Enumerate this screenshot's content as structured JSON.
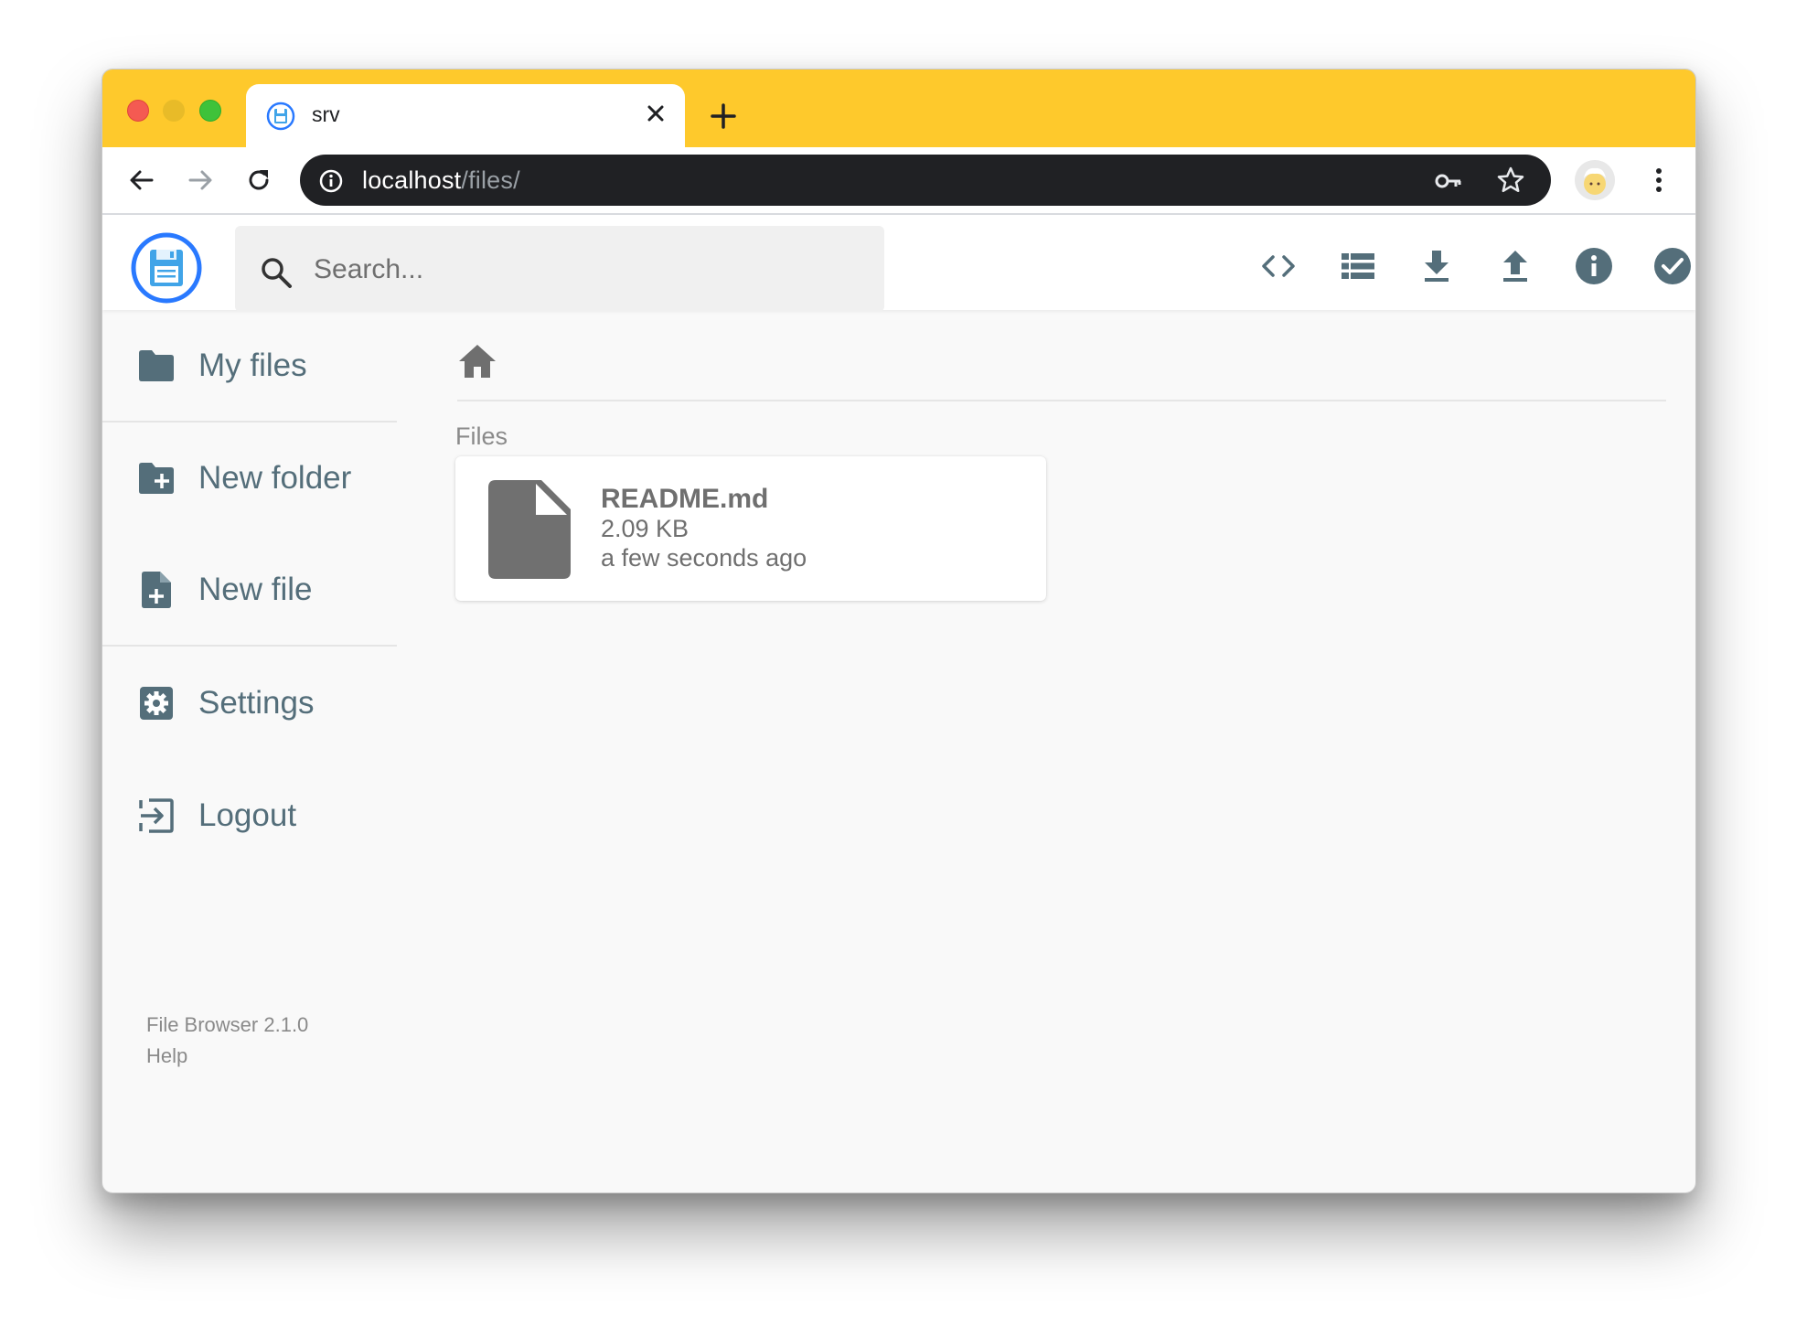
{
  "browser": {
    "tab_title": "srv",
    "url_host": "localhost",
    "url_path": "/files/"
  },
  "header": {
    "search_placeholder": "Search...",
    "actions": [
      "code-view",
      "list-view",
      "download",
      "upload",
      "info",
      "select"
    ]
  },
  "sidebar": {
    "items": [
      {
        "label": "My files",
        "icon": "folder-icon"
      },
      {
        "label": "New folder",
        "icon": "new-folder-icon"
      },
      {
        "label": "New file",
        "icon": "new-file-icon"
      },
      {
        "label": "Settings",
        "icon": "settings-icon"
      },
      {
        "label": "Logout",
        "icon": "logout-icon"
      }
    ],
    "version": "File Browser 2.1.0",
    "help": "Help"
  },
  "main": {
    "section_title": "Files",
    "files": [
      {
        "name": "README.md",
        "size": "2.09 KB",
        "modified": "a few seconds ago",
        "icon": "file-icon"
      }
    ]
  },
  "colors": {
    "tab_strip": "#fec92c",
    "icon_slate": "#546e7a",
    "accent_blue": "#2979ff"
  }
}
